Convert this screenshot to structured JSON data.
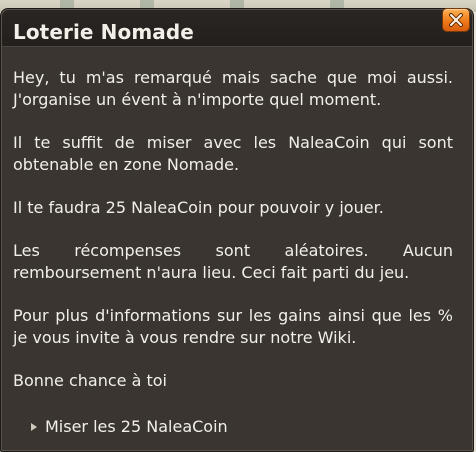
{
  "dialog": {
    "title": "Loterie Nomade",
    "close_icon": "close-x-icon",
    "paragraphs": [
      "Hey, tu m'as remarqué mais sache que moi aussi. J'organise un évent à n'importe quel moment.",
      "Il te suffit de miser avec les NaleaCoin qui sont obtenable en zone Nomade.",
      "Il te faudra 25 NaleaCoin pour pouvoir y jouer.",
      "Les récompenses sont aléatoires. Aucun remboursement n'aura lieu. Ceci fait parti du jeu.",
      "Pour plus d'informations sur les gains ainsi que les % je vous invite à vous rendre sur notre Wiki.",
      "Bonne chance à toi"
    ],
    "choices": [
      {
        "label": "Miser les 25 NaleaCoin",
        "icon": "triangle-right-icon"
      }
    ]
  },
  "colors": {
    "panel_background": "#3a3530",
    "header_background": "#231f1c",
    "text": "#f2efe8",
    "close_button": "#f07a1a"
  }
}
